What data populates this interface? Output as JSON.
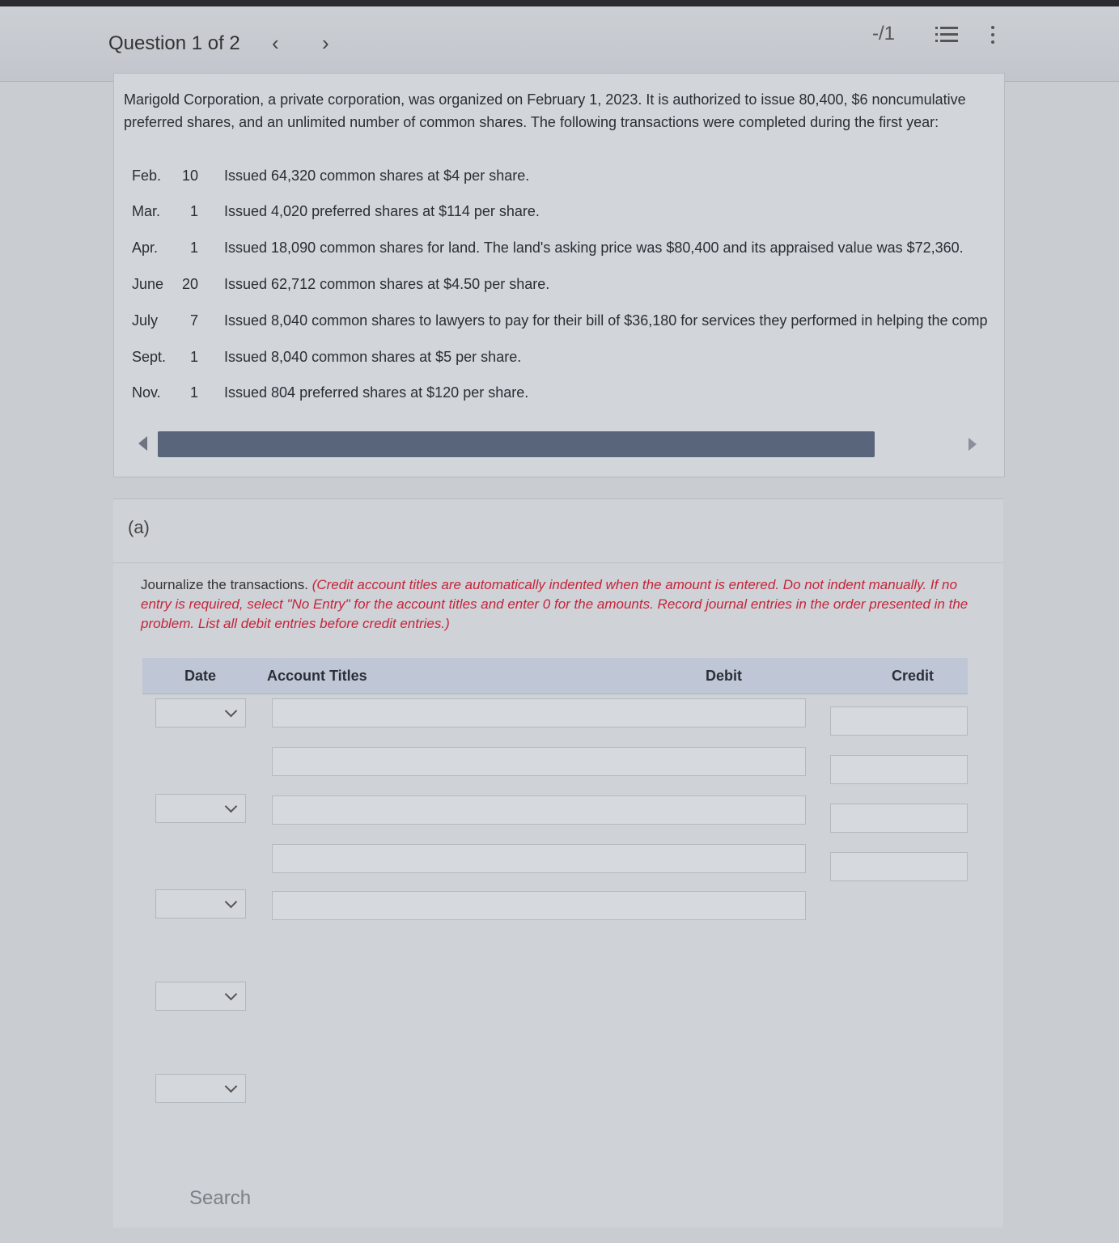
{
  "header": {
    "question_label": "Question 1 of 2",
    "prev_glyph": "‹",
    "next_glyph": "›",
    "progress": "-/1",
    "list_icon": "list-icon",
    "more_icon": "more-vertical-icon"
  },
  "problem": {
    "intro": "Marigold Corporation, a private corporation, was organized on February 1, 2023. It is authorized to issue 80,400, $6 noncumulative preferred shares, and an unlimited number of common shares. The following transactions were completed during the first year:",
    "transactions": [
      {
        "month": "Feb.",
        "day": "10",
        "desc": "Issued 64,320 common shares at $4 per share."
      },
      {
        "month": "Mar.",
        "day": "1",
        "desc": "Issued 4,020 preferred shares at $114 per share."
      },
      {
        "month": "Apr.",
        "day": "1",
        "desc": "Issued 18,090 common shares for land. The land's asking price was $80,400 and its appraised value was $72,360."
      },
      {
        "month": "June",
        "day": "20",
        "desc": "Issued 62,712 common shares at $4.50 per share."
      },
      {
        "month": "July",
        "day": "7",
        "desc": "Issued 8,040 common shares to lawyers to pay for their bill of $36,180 for services they performed in helping the comp"
      },
      {
        "month": "Sept.",
        "day": "1",
        "desc": "Issued 8,040 common shares at $5 per share."
      },
      {
        "month": "Nov.",
        "day": "1",
        "desc": "Issued 804 preferred shares at $120 per share."
      }
    ]
  },
  "part": {
    "label": "(a)",
    "instruction_plain": "Journalize the transactions.",
    "instruction_red": "(Credit account titles are automatically indented when the amount is entered. Do not indent manually. If no entry is required, select \"No Entry\" for the account titles and enter 0 for the amounts. Record journal entries in the order presented in the problem. List all debit entries before credit entries.)"
  },
  "table": {
    "headers": {
      "date": "Date",
      "account": "Account Titles",
      "debit": "Debit",
      "credit": "Credit"
    }
  },
  "search_label": "Search"
}
